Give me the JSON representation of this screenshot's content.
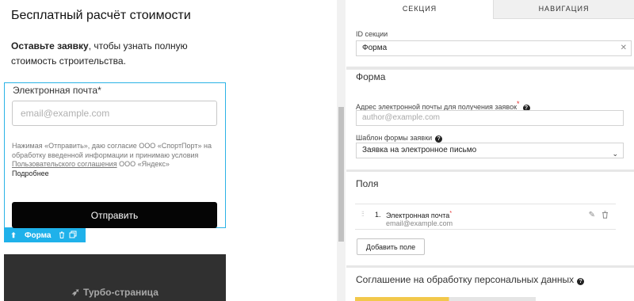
{
  "preview": {
    "heading": "Бесплатный расчёт стоимости",
    "desc_bold": "Оставьте заявку",
    "desc_rest": ", чтобы узнать полную стоимость строительства.",
    "email_label": "Электронная почта*",
    "email_placeholder": "email@example.com",
    "consent_text": "Нажимая «Отправить», даю согласие ООО «СпортПорт» на обработку введенной информации и принимаю условия ",
    "consent_link": "Пользовательского соглашения",
    "consent_tail": " ООО «Яндекс»",
    "consent_more": "Подробнее",
    "submit_label": "Отправить",
    "toolbar_label": "Форма",
    "footer_text": "Турбо-страница"
  },
  "panel": {
    "tabs": [
      "СЕКЦИЯ",
      "НАВИГАЦИЯ"
    ],
    "section_id_label": "ID секции",
    "section_id_value": "Форма",
    "form_title": "Форма",
    "email_addr_label": "Адрес электронной почты для получения заявок",
    "email_addr_placeholder": "author@example.com",
    "template_label": "Шаблон формы заявки",
    "template_value": "Заявка на электронное письмо",
    "fields_title": "Поля",
    "field_items": [
      {
        "num": "1.",
        "name": "Электронная почта",
        "sub": "email@example.com"
      }
    ],
    "add_field_label": "Добавить поле",
    "consent_title": "Соглашение на обработку персональных данных"
  },
  "icons": {
    "pin": "pin-icon",
    "trash": "trash-icon",
    "copy": "copy-icon",
    "rocket": "rocket-icon",
    "help": "help-icon",
    "chevron": "chevron-down-icon",
    "close": "close-icon",
    "drag": "drag-handle-icon",
    "pencil": "pencil-icon"
  },
  "colors": {
    "selection": "#2bb3e6",
    "toolbar": "#1fb1ea",
    "button": "#050505",
    "footer": "#303030",
    "required": "#e52b2b",
    "accent": "#f2c84b"
  }
}
